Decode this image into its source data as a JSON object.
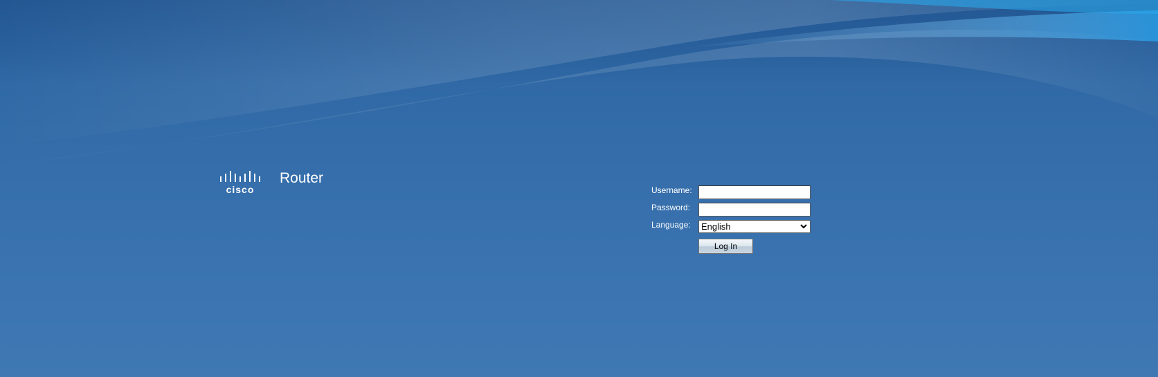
{
  "header": {
    "brand": "cisco",
    "product": "Router"
  },
  "login": {
    "username_label": "Username:",
    "username_value": "",
    "password_label": "Password:",
    "password_value": "",
    "language_label": "Language:",
    "language_selected": "English",
    "login_button_label": "Log In"
  },
  "icons": {
    "logo": "cisco-logo-icon",
    "dropdown": "chevron-down-icon"
  },
  "colors": {
    "background": "#336ca8",
    "text": "#ffffff"
  }
}
